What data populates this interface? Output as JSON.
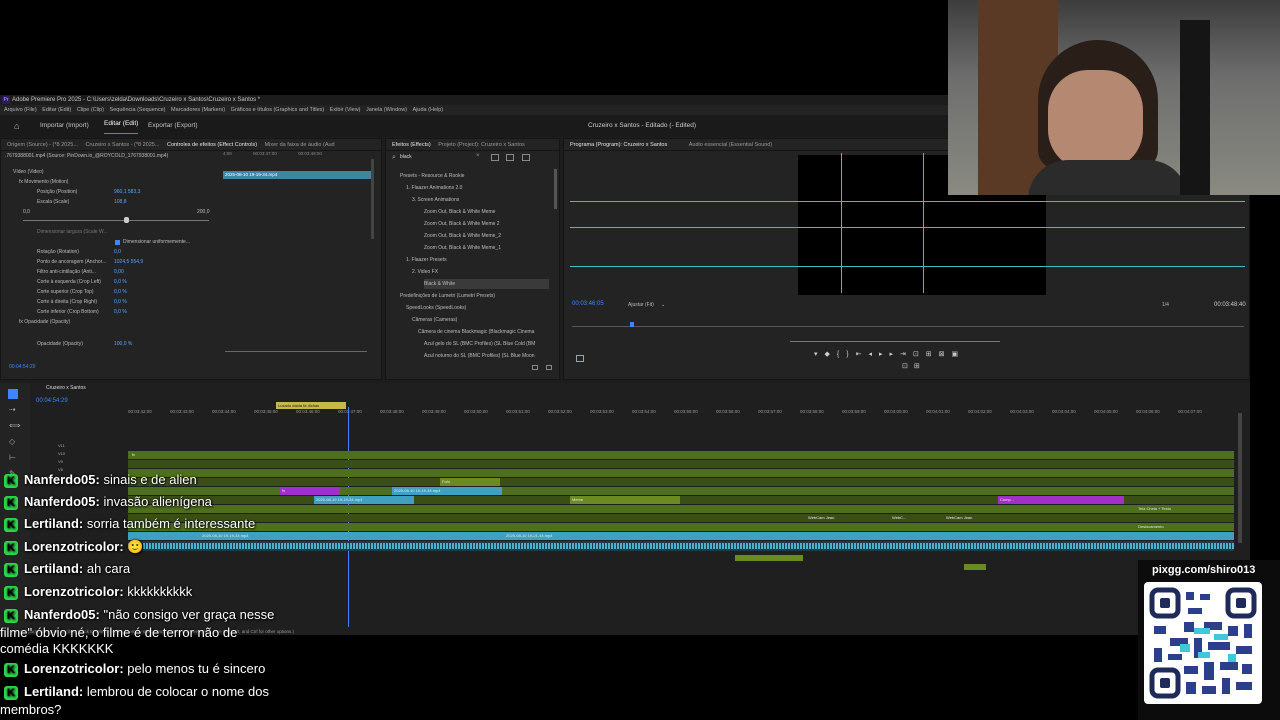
{
  "window": {
    "title": "Adobe Premiere Pro 2025 - C:\\Users\\zelda\\Downloads\\Cruzeiro x Santos\\Cruzeiro x Santos *",
    "app_badge": "Pr",
    "menu": [
      "Arquivo (File)",
      "Editar (Edit)",
      "Clipe (Clip)",
      "Sequência (Sequence)",
      "Marcadores (Markers)",
      "Gráficos e títulos (Graphics and Titles)",
      "Exibir (View)",
      "Janela (Window)",
      "Ajuda (Help)"
    ],
    "workspaces": {
      "import": "Importar (Import)",
      "edit": "Editar (Edit)",
      "export": "Exportar (Export)",
      "project_name": "Cruzeiro x Santos - Editado (- Edited)"
    }
  },
  "source_panel": {
    "tabs": [
      "Origem (Source) - (*8 2025...",
      "Cruzeiro x Santos - (*8 2025...",
      "Controles de efeitos (Effect Controls)",
      "Mixer da faixa de áudio (Aud"
    ],
    "clip_path": ".7679388001.mp4 (Source: PinDown.io_@ROYCOLD_1767938001.mp4)",
    "ruler_times": [
      "4:00",
      "00:03:47:00",
      "00:03:48:00"
    ],
    "clip_label": "2025-08-10 19-19-34.mp4",
    "rows": [
      {
        "label": "Vídeo (Video)",
        "value": ""
      },
      {
        "label": "fx Movimento (Motion)",
        "value": ""
      },
      {
        "label": "Posição (Position)",
        "value": "960,1   583,3"
      },
      {
        "label": "Escala (Scale)",
        "value": "108,8"
      },
      {
        "label": "0,0",
        "value": "200,0"
      },
      {
        "label": "Dimensionar largura (Scale W...",
        "value": ""
      },
      {
        "label": "Dimensionar uniformemente...",
        "value": ""
      },
      {
        "label": "Rotação (Rotation)",
        "value": "0,0"
      },
      {
        "label": "Ponto de ancoragem (Anchor...",
        "value": "1024,5   554,9"
      },
      {
        "label": "Filtro anti-cintilação (Anti...",
        "value": "0,00"
      },
      {
        "label": "Corte à esquerda (Crop Left)",
        "value": "0,0 %"
      },
      {
        "label": "Corte superior (Crop Top)",
        "value": "0,0 %"
      },
      {
        "label": "Corte à direita (Crop Right)",
        "value": "0,0 %"
      },
      {
        "label": "Corte inferior (Crop Bottom)",
        "value": "0,0 %"
      },
      {
        "label": "fx Opacidade (Opacity)",
        "value": ""
      },
      {
        "label": "Opacidade (Opacity)",
        "value": "100,0 %"
      }
    ],
    "timecode": "00:04:54:29"
  },
  "effects_panel": {
    "tabs": [
      "Efeitos (Effects)",
      "Projeto (Project): Cruzeiro x Santos"
    ],
    "search_value": "black",
    "tree": [
      "Presets - Resource & Rookie",
      "1. Flaazer Animations 2.0",
      "3. Screen Animations",
      "Zoom Out, Black & White Meme",
      "Zoom Out, Black & White Meme 2",
      "Zoom Out, Black & White Meme_2",
      "Zoom Out, Black & White Meme_1",
      "1. Flaazer Presets",
      "2. Video FX",
      "Black & White",
      "Predefinições de Lumetri (Lumetri Presets)",
      "SpeedLooks (SpeedLooks)",
      "Câmeras (Cameras)",
      "Câmera de cinema Blackmagic (Blackmagic Cinema",
      "Azul gelo do SL (BMC Profiles) (SL Blue Cold (BM",
      "Azul noturno do SL (BMC Profiles) (SL Blue Moon"
    ]
  },
  "program_panel": {
    "tabs": [
      "Programa (Program): Cruzeiro x Santos",
      "Áudio essencial (Essential Sound)"
    ],
    "timecode_left": "00:03:46:05",
    "fit_label": "Ajustar (Fit)",
    "resolution": "1/4",
    "timecode_right": "00:03:48:40"
  },
  "timeline": {
    "sequence_tab": "Cruzeiro x Santos",
    "timecode": "00:04:54:29",
    "marker_label": "Lusado dalda fa dlchas",
    "ruler": [
      "00:03:42:00",
      "00:03:43:00",
      "00:03:44:00",
      "00:03:45:00",
      "00:03:46:00",
      "00:03:47:00",
      "00:03:48:00",
      "00:03:49:00",
      "00:03:50:00",
      "00:03:51:00",
      "00:03:52:00",
      "00:03:53:00",
      "00:03:54:00",
      "00:03:55:00",
      "00:03:56:00",
      "00:03:57:00",
      "00:03:58:00",
      "00:03:59:00",
      "00:04:00:00",
      "00:04:01:00",
      "00:04:02:00",
      "00:04:03:00",
      "00:04:04:00",
      "00:04:05:00",
      "00:04:06:00",
      "00:04:07:00"
    ],
    "track_labels": [
      "V11",
      "V10",
      "V9",
      "V8",
      "V7",
      "V6",
      "V5",
      "V4",
      "V3",
      "V2",
      "V1",
      "A1",
      "A2",
      "A3"
    ],
    "clips": {
      "fx": "fx",
      "fofo": "Fofo",
      "meme": "Meme",
      "comp": "Comp...",
      "webcam": "WebCam Jean",
      "webc_short": "WebC...",
      "vid_label": "2025-08-10 19-19-34.mp4",
      "tela_cheia": "Tela Cheia + Texto",
      "deslocamento": "Deslocamento",
      "vid2": "2025-08-10 19-19-34.mp4",
      "vid3": "2025-08-10 19-21-44.mp4"
    },
    "status": "Alt+Ctrl para obter mais opções. (Click to select, or click in empty space and drag to marquee select. Use Shift, Alt, and Ctrl for other options.)"
  },
  "chat": [
    {
      "user": "Nanferdo05:",
      "message": "sinais e de alien"
    },
    {
      "user": "Nanferdo05:",
      "message": "invasão alienígena"
    },
    {
      "user": "Lertiland:",
      "message": "sorria também é interessante"
    },
    {
      "user": "Lorenzotricolor:",
      "message": "🙂"
    },
    {
      "user": "Lertiland:",
      "message": "ah cara"
    },
    {
      "user": "Lorenzotricolor:",
      "message": "kkkkkkkkkk"
    },
    {
      "user": "Nanferdo05:",
      "message": "\"não consigo ver graça nesse"
    },
    {
      "user": "",
      "message": "filme\" óbvio né, o filme é de terror não de"
    },
    {
      "user": "",
      "message": "comédia KKKKKKK"
    },
    {
      "user": "Lorenzotricolor:",
      "message": "pelo menos tu é sincero"
    },
    {
      "user": "Lertiland:",
      "message": "lembrou de colocar o nome dos"
    },
    {
      "user": "",
      "message": "membros?"
    }
  ],
  "overlay": {
    "pix_url": "pixgg.com/shiro013"
  },
  "colors": {
    "accent_blue": "#3d86ff",
    "track_green": "#4e6f1d",
    "audio_blue": "#3fa0c0",
    "kick_green": "#2ad84a",
    "clip_purple": "#a030c8"
  }
}
